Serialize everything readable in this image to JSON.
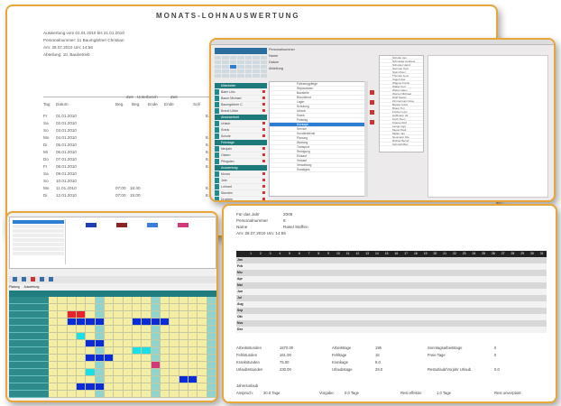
{
  "report": {
    "title": "MONATS-LOHNAUSWERTUNG",
    "head_lines": [
      "Auswertung vom  01.01.2010  bis  31.01.2010",
      "Personalnummer:  11  Baumgärtner Christian",
      "Am: 28.07.2010 Um: 14:56",
      "Abteilung:  10, Baubetrieb"
    ],
    "col_labels": {
      "soll": "Soll",
      "unterbrech": "Unterbrech",
      "zeit": "Zeit",
      "tag": "Tag",
      "datum": "Datum",
      "beg1": "Beg.",
      "beg2": "Beg.",
      "ende1": "Ende",
      "ende2": "Ende",
      "soll2": "Soll",
      "arbeit": "Arbeit"
    },
    "rows": [
      {
        "d": "Fr",
        "dt": "01.01.2010",
        "vb": "",
        "ve": "",
        "s": "8.00",
        "a": "0.00"
      },
      {
        "d": "Sa",
        "dt": "02.01.2010",
        "vb": "",
        "ve": "",
        "s": "",
        "a": ""
      },
      {
        "d": "So",
        "dt": "03.01.2010",
        "vb": "",
        "ve": "",
        "s": "",
        "a": ""
      },
      {
        "d": "Mo",
        "dt": "04.01.2010",
        "vb": "",
        "ve": "",
        "s": "8.00",
        "a": "0.00"
      },
      {
        "d": "Di",
        "dt": "05.01.2010",
        "vb": "",
        "ve": "",
        "s": "8.00",
        "a": "0.00"
      },
      {
        "d": "Mi",
        "dt": "06.01.2010",
        "vb": "",
        "ve": "",
        "s": "8.00",
        "a": "0.00"
      },
      {
        "d": "Do",
        "dt": "07.01.2010",
        "vb": "",
        "ve": "",
        "s": "8.00",
        "a": "0.00"
      },
      {
        "d": "Fr",
        "dt": "08.01.2010",
        "vb": "",
        "ve": "",
        "s": "8.00",
        "a": "0.00"
      },
      {
        "d": "Sa",
        "dt": "09.01.2010",
        "vb": "",
        "ve": "",
        "s": "",
        "a": ""
      },
      {
        "d": "So",
        "dt": "10.01.2010",
        "vb": "",
        "ve": "",
        "s": "",
        "a": ""
      },
      {
        "d": "Mo",
        "dt": "11.01.2010",
        "vb": "07:00",
        "ve": "16:40",
        "s": "8.00",
        "a": "7.40"
      },
      {
        "d": "Di",
        "dt": "12.01.2010",
        "vb": "07:00",
        "ve": "15:00",
        "s": "8.00",
        "a": "0.00"
      }
    ]
  },
  "window": {
    "mid_labels": [
      "Personalnummer",
      "Name",
      "Datum",
      "Abteilung"
    ],
    "side_items": [
      {
        "label": "Mitarbeiter",
        "head": true
      },
      {
        "label": "Baier Udo",
        "head": false
      },
      {
        "label": "Bauer Michael",
        "head": false
      },
      {
        "label": "Baumgärtner C.",
        "head": false
      },
      {
        "label": "Brand Ulrich",
        "head": false
      },
      {
        "label": "Abwesenheit",
        "head": true
      },
      {
        "label": "Urlaub",
        "head": false
      },
      {
        "label": "Krank",
        "head": false
      },
      {
        "label": "Schule",
        "head": false
      },
      {
        "label": "Feiertage",
        "head": true
      },
      {
        "label": "Neujahr",
        "head": false
      },
      {
        "label": "Ostern",
        "head": false
      },
      {
        "label": "Pfingsten",
        "head": false
      },
      {
        "label": "Auswertung",
        "head": true
      },
      {
        "label": "Monat",
        "head": false
      },
      {
        "label": "Jahr",
        "head": false
      },
      {
        "label": "Lohnart",
        "head": false
      },
      {
        "label": "Stunden",
        "head": false
      },
      {
        "label": "Drucken",
        "head": false
      }
    ],
    "mid_rows": [
      "Fahrzeugpflege",
      "Reparaturen",
      "Baustelle",
      "Bürodienst",
      "Lager",
      "Schulung",
      "Urlaub",
      "Krank",
      "Feiertag",
      "Montage",
      "Service",
      "Kundendienst",
      "Planung",
      "Wartung",
      "Transport",
      "Reinigung",
      "Einkauf",
      "Verkauf",
      "Verwaltung",
      "Sonstiges"
    ],
    "right_rows": [
      "Schulte Jan",
      "Schneider Andreas",
      "Schuster Heinz",
      "Sommer Karl",
      "Stein Peter",
      "Thomas Jens",
      "Vogel Uwe",
      "Wagner Frank",
      "Walter Kurt",
      "Weber Hans",
      "Werner Michael",
      "Wolf Stefan",
      "Zimmermann Eva",
      "Becker Anna",
      "Braun Tim",
      "Fischer Lars",
      "Hoffmann Uli",
      "Koch Sven",
      "Krause Rolf",
      "Lange Ingo",
      "Meyer Paul",
      "Müller Jan",
      "Neumann Ole",
      "Richter Bernd",
      "Schmidt Max"
    ],
    "selected_mid_row": 9
  },
  "plan": {
    "tabs": [
      "Planung",
      "Auswertung"
    ],
    "legend": [
      {
        "color": "#1f3fb8"
      },
      {
        "color": "#8b2323"
      },
      {
        "color": "#3a7de0"
      },
      {
        "color": "#d23a7a"
      }
    ],
    "rows": 14,
    "cols": 18
  },
  "year": {
    "head": [
      [
        "Für das Jahr",
        "2009"
      ],
      [
        "Personalnummer",
        "8"
      ],
      [
        "Name",
        "Rasel Steffen"
      ],
      [
        "Am: 28.07.2010 Um: 14:56",
        ""
      ]
    ],
    "months": [
      "Jan",
      "Feb",
      "Mrz",
      "Apr",
      "Mai",
      "Jun",
      "Jul",
      "Aug",
      "Sep",
      "Okt",
      "Nov",
      "Dez"
    ],
    "day_headers": [
      "1",
      "2",
      "3",
      "4",
      "5",
      "6",
      "7",
      "8",
      "9",
      "10",
      "11",
      "12",
      "13",
      "14",
      "15",
      "16",
      "17",
      "18",
      "19",
      "20",
      "21",
      "22",
      "23",
      "24",
      "25",
      "26",
      "27",
      "28",
      "29",
      "30",
      "31"
    ],
    "summary": [
      [
        [
          "Arbeitsstunden",
          "1670.00"
        ],
        [
          "Fehlstunden",
          "161.00"
        ],
        [
          "Krankstunden",
          "75.00"
        ],
        [
          "Urlaubsstunden",
          "230.00"
        ]
      ],
      [
        [
          "Arbeitstage",
          "196"
        ],
        [
          "Fehltage",
          "16"
        ],
        [
          "Krankage",
          "9.0"
        ],
        [
          "Urlaubstage",
          "29.0"
        ]
      ],
      [
        [
          "Sonntagsarbeitstage",
          "0"
        ],
        [
          "Freie Tage",
          "0"
        ],
        [
          "",
          ""
        ],
        [
          "Resturlaub/Vorjahr Urlaub",
          "0.0"
        ]
      ]
    ],
    "footer": {
      "label": "Jahresurlaub",
      "anspruch": "Anspruch:",
      "anspruch_val": "30.0 Tage",
      "vorgabe": "Vorgabe:",
      "vorgabe_val": "0.0 Tage",
      "rest": "Rest effektiv:",
      "rest_val": "1.0 Tage",
      "rest_unver": "Rest unverplant:"
    }
  }
}
